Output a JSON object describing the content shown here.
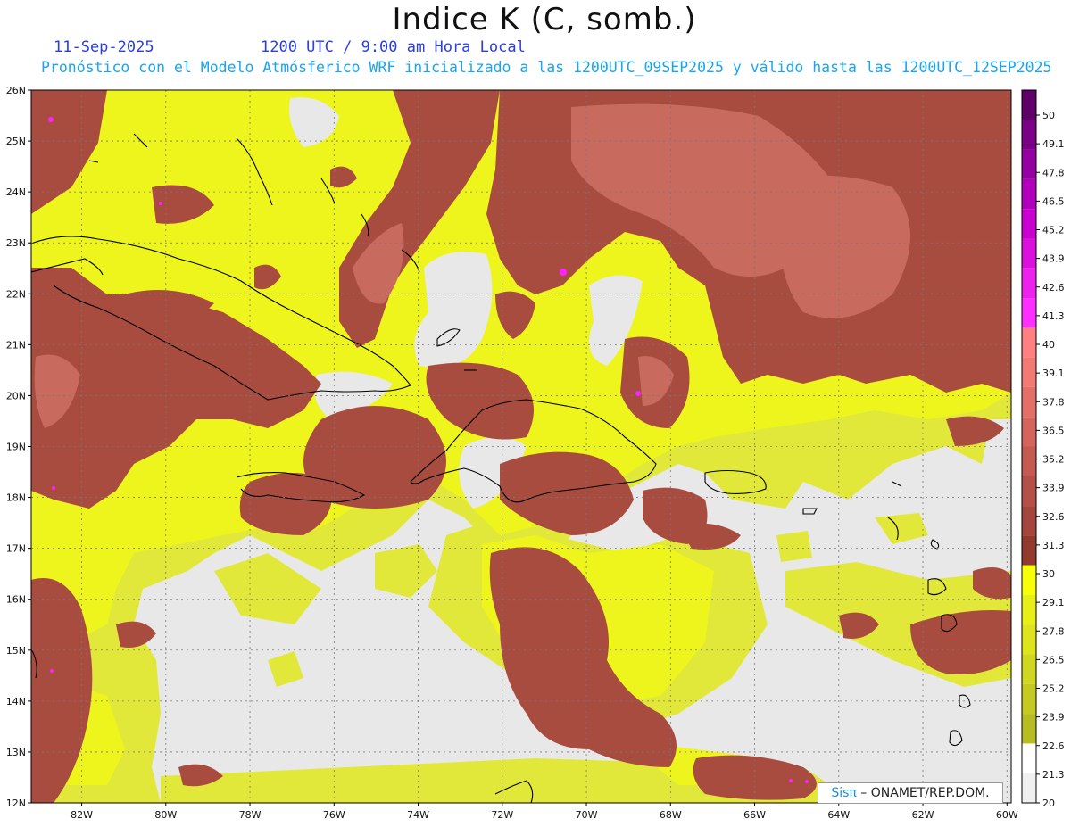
{
  "title": "Indice K (C, somb.)",
  "date": "11-Sep-2025",
  "valid_time": "1200 UTC / 9:00 am Hora Local",
  "subtitle": "Pronóstico con el Modelo Atmósferico WRF inicializado a las 1200UTC_09SEP2025 y válido hasta las  1200UTC_12SEP2025",
  "credit": {
    "brand": "Sisπ",
    "text": " – ONAMET/REP.DOM."
  },
  "map": {
    "lat_range": [
      12,
      26
    ],
    "lon_range": [
      -83.2,
      -59.9
    ],
    "lat_ticks": [
      "12N",
      "13N",
      "14N",
      "15N",
      "16N",
      "17N",
      "18N",
      "19N",
      "20N",
      "21N",
      "22N",
      "23N",
      "24N",
      "25N",
      "26N"
    ],
    "lon_ticks": [
      "82W",
      "80W",
      "78W",
      "76W",
      "74W",
      "72W",
      "70W",
      "68W",
      "66W",
      "64W",
      "62W",
      "60W"
    ]
  },
  "colorbar": {
    "labels": [
      "50",
      "49.1",
      "47.8",
      "46.5",
      "45.2",
      "43.9",
      "42.6",
      "41.3",
      "40",
      "39.1",
      "37.8",
      "36.5",
      "35.2",
      "33.9",
      "32.6",
      "31.3",
      "30",
      "29.1",
      "27.8",
      "26.5",
      "25.2",
      "23.9",
      "22.6",
      "21.3",
      "20"
    ],
    "colors": [
      "#5e0068",
      "#7a0085",
      "#9500a0",
      "#b000bb",
      "#c800d0",
      "#dc10dc",
      "#ee20ee",
      "#ff30ff",
      "#ff8080",
      "#f27a74",
      "#e26f68",
      "#d4655e",
      "#c45a52",
      "#b45048",
      "#a4463e",
      "#923a2e",
      "#f6ff08",
      "#e8ef18",
      "#dde41c",
      "#d0d720",
      "#c4ca22",
      "#b6bd22",
      "#f0f0f0"
    ]
  },
  "colors": {
    "background_field": "#e8e8e8",
    "low_band": "#dfe43a",
    "mid_band": "#e9f222",
    "high_band": "#a64a3e",
    "high_core": "#c86458",
    "peak": "#ff22ff",
    "coast": "#000000",
    "title_blue": "#2a3fe0",
    "subtitle_blue": "#1aa5f0"
  }
}
